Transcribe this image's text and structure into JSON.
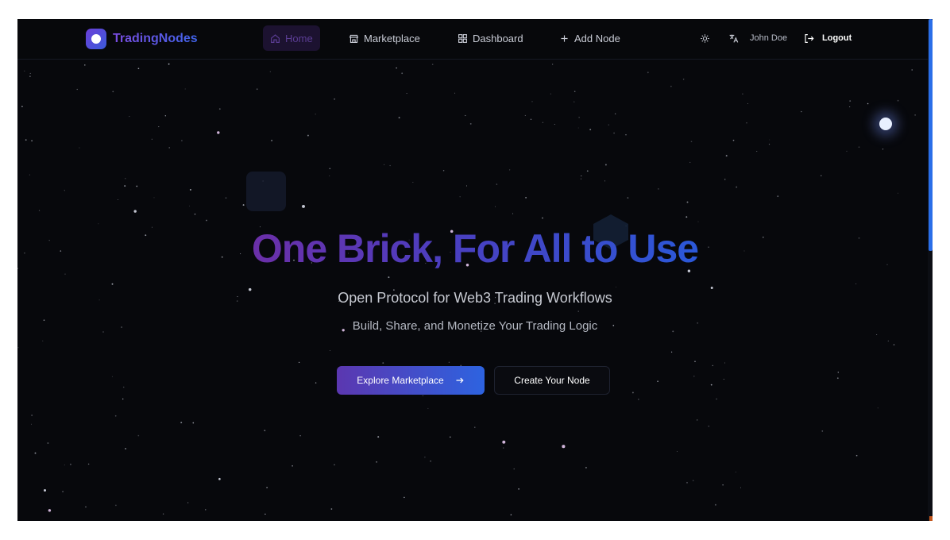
{
  "brand": {
    "name": "TradingNodes"
  },
  "nav": {
    "items": [
      {
        "label": "Home",
        "icon": "home-icon",
        "active": true
      },
      {
        "label": "Marketplace",
        "icon": "store-icon",
        "active": false
      },
      {
        "label": "Dashboard",
        "icon": "grid-icon",
        "active": false
      },
      {
        "label": "Add Node",
        "icon": "plus-icon",
        "active": false
      }
    ],
    "theme_icon": "sun-icon",
    "language_icon": "translate-icon",
    "user_name": "John Doe",
    "logout_label": "Logout"
  },
  "hero": {
    "title": "One Brick, For All to Use",
    "subtitle": "Open Protocol for Web3 Trading Workflows",
    "tagline": "Build, Share, and Monetize Your Trading Logic",
    "primary_button": "Explore Marketplace",
    "secondary_button": "Create Your Node"
  },
  "colors": {
    "background": "#07080c",
    "accent_purple": "#6b2fa8",
    "accent_blue": "#2b58d8",
    "scrollbar": "#2a6ee8"
  }
}
